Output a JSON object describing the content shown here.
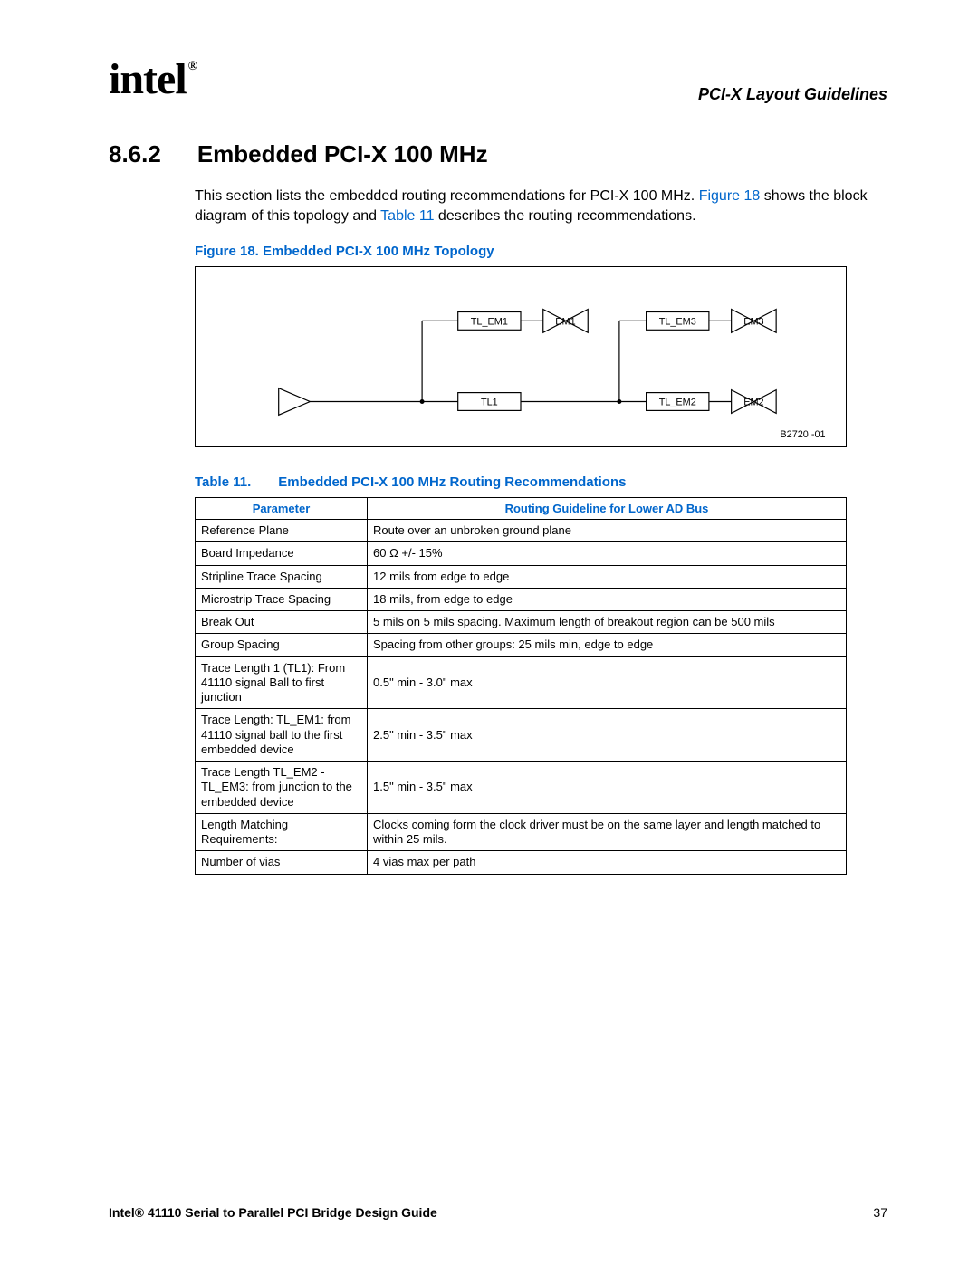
{
  "header": {
    "logo_text": "intel",
    "reg_mark": "®",
    "doc_section": "PCI-X Layout Guidelines"
  },
  "section": {
    "number": "8.6.2",
    "title": "Embedded PCI-X 100 MHz"
  },
  "intro": {
    "pre": "This section lists the embedded routing recommendations for PCI-X 100 MHz. ",
    "fig_link": "Figure 18",
    "mid": " shows the block diagram of this topology and ",
    "tbl_link": "Table 11",
    "post": " describes the routing recommendations."
  },
  "figure": {
    "caption": "Figure 18. Embedded PCI-X 100 MHz Topology",
    "labels": {
      "tl_em1": "TL_EM1",
      "em1": "EM1",
      "tl_em3": "TL_EM3",
      "em3": "EM3",
      "tl1": "TL1",
      "tl_em2": "TL_EM2",
      "em2": "EM2"
    },
    "ref": "B2720 -01"
  },
  "table": {
    "caption_label": "Table 11.",
    "caption_title": "Embedded PCI-X 100 MHz Routing Recommendations",
    "headers": [
      "Parameter",
      "Routing Guideline for Lower AD Bus"
    ],
    "rows": [
      [
        "Reference Plane",
        "Route over an unbroken ground plane"
      ],
      [
        "Board Impedance",
        "60 Ω +/- 15%"
      ],
      [
        "Stripline Trace Spacing",
        "12 mils from edge to edge"
      ],
      [
        "Microstrip Trace Spacing",
        "18 mils, from edge to edge"
      ],
      [
        "Break Out",
        "5 mils on 5 mils spacing. Maximum length of breakout region can be 500 mils"
      ],
      [
        "Group Spacing",
        "Spacing from other groups: 25 mils min, edge to edge"
      ],
      [
        "Trace Length 1 (TL1): From 41110 signal Ball to first junction",
        "0.5\" min - 3.0\" max"
      ],
      [
        "Trace Length: TL_EM1: from 41110 signal ball to the first embedded device",
        "2.5\" min - 3.5\" max"
      ],
      [
        "Trace Length TL_EM2 - TL_EM3: from junction to the embedded device",
        "1.5\" min - 3.5\" max"
      ],
      [
        "Length Matching Requirements:",
        "Clocks coming form the clock driver must be on the same layer and length matched to within 25 mils."
      ],
      [
        "Number of vias",
        "4 vias max per path"
      ]
    ]
  },
  "footer": {
    "title": "Intel® 41110 Serial to Parallel PCI Bridge Design Guide",
    "page": "37"
  }
}
